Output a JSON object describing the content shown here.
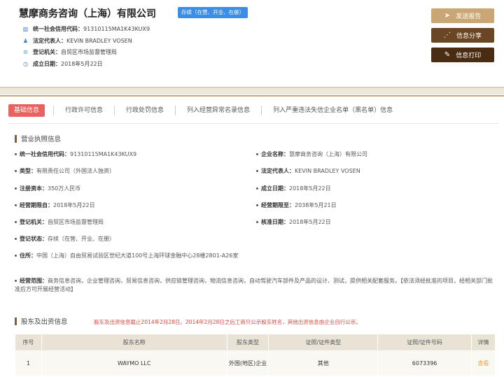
{
  "header": {
    "company_name": "慧摩商务咨询（上海）有限公司",
    "status": "存续（在营、开业、在册）",
    "lines": [
      {
        "icon": "barcode-icon",
        "label": "统一社会信用代码：",
        "value": "91310115MA1K43KUX9"
      },
      {
        "icon": "person-icon",
        "label": "法定代表人：",
        "value": "KEVIN BRADLEY VOSEN"
      },
      {
        "icon": "location-icon",
        "label": "登记机关：",
        "value": "自贸区市场监督管理局"
      },
      {
        "icon": "clock-icon",
        "label": "成立日期：",
        "value": "2018年5月22日"
      }
    ]
  },
  "actions": {
    "report": "发送报告",
    "share": "信息分享",
    "print": "信息打印"
  },
  "tabs": [
    "基础信息",
    "行政许可信息",
    "行政处罚信息",
    "列入经营异常名录信息",
    "列入严重违法失信企业名单（黑名单）信息"
  ],
  "license": {
    "title": "营业执照信息",
    "left": [
      {
        "label": "统一社会信用代码：",
        "value": "91310115MA1K43KUX9"
      },
      {
        "label": "类型：",
        "value": "有限责任公司（外国法人独资）"
      },
      {
        "label": "注册资本：",
        "value": "350万人民币"
      },
      {
        "label": "经营期限自：",
        "value": "2018年5月22日"
      },
      {
        "label": "登记机关：",
        "value": "自贸区市场监督管理局"
      },
      {
        "label": "登记状态：",
        "value": "存续（在营、开业、在册）"
      }
    ],
    "right": [
      {
        "label": "企业名称：",
        "value": "慧摩商务咨询（上海）有限公司"
      },
      {
        "label": "法定代表人：",
        "value": "KEVIN BRADLEY VOSEN"
      },
      {
        "label": "成立日期：",
        "value": "2018年5月22日"
      },
      {
        "label": "经营期限至：",
        "value": "2038年5月21日"
      },
      {
        "label": "核准日期：",
        "value": "2018年5月22日"
      }
    ],
    "address_label": "住所：",
    "address": "中国（上海）自由贸易试验区世纪大道100号上海环球金融中心28楼2801-A26室",
    "scope_label": "经营范围：",
    "scope": "商务信息咨询，企业管理咨询，贸易信息咨询，供应链管理咨询，物流信息咨询，自动驾驶汽车部件及产品的设计、测试，提供相关配套服务。【依法须经批准的项目，经相关部门批准后方可开展经营活动】"
  },
  "shareholders": {
    "title": "股东及出资信息",
    "notice": "股东及出资信息截止2014年2月28日。2014年2月28日之后工商只公示股东姓名，其他出资信息由企业自行公示。",
    "columns": [
      "序号",
      "股东名称",
      "股东类型",
      "证照/证件类型",
      "证照/证件号码",
      "详情"
    ],
    "rows": [
      {
        "no": "1",
        "name": "WAYMO LLC",
        "type": "外国(地区)企业",
        "id_type": "其他",
        "id_no": "6073396",
        "detail": "查看"
      }
    ]
  }
}
